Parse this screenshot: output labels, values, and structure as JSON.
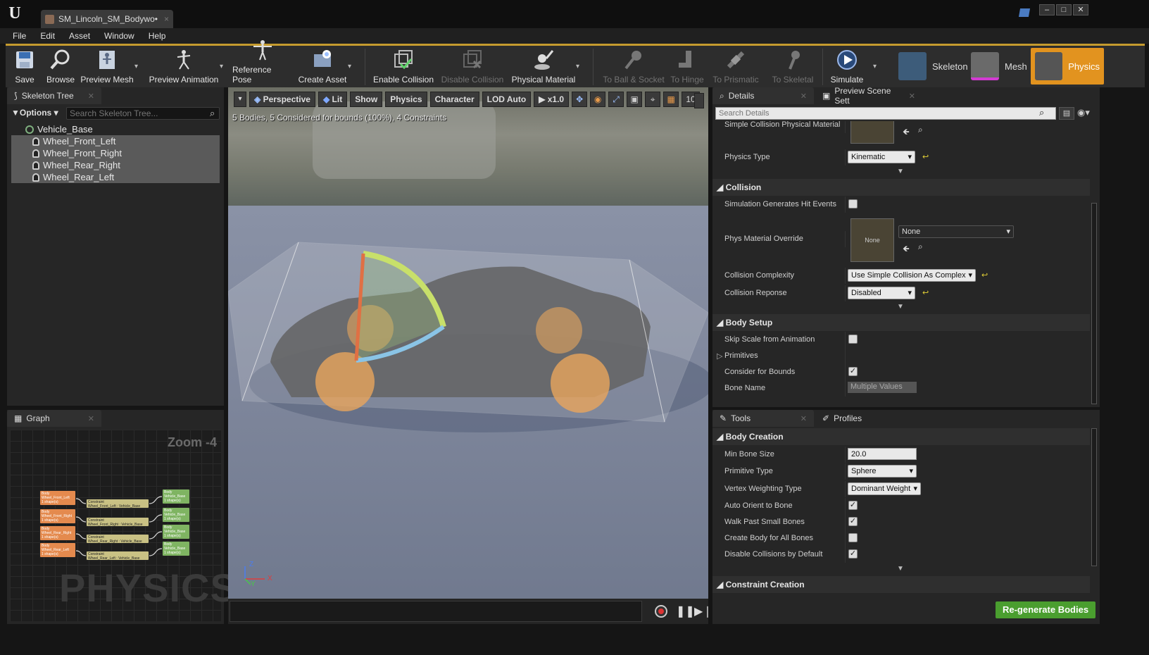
{
  "window": {
    "tab_title": "SM_Lincoln_SM_Bodywo•",
    "tab_close": "×",
    "min": "–",
    "max": "□",
    "close": "✕"
  },
  "menu": [
    "File",
    "Edit",
    "Asset",
    "Window",
    "Help"
  ],
  "toolbar": {
    "save": "Save",
    "browse": "Browse",
    "preview_mesh": "Preview Mesh",
    "preview_animation": "Preview Animation",
    "reference_pose": "Reference Pose",
    "create_asset": "Create Asset",
    "enable_collision": "Enable Collision",
    "disable_collision": "Disable Collision",
    "physical_material": "Physical Material",
    "to_ball_socket": "To Ball & Socket",
    "to_hinge": "To Hinge",
    "to_prismatic": "To Prismatic",
    "to_skeletal": "To Skeletal",
    "simulate": "Simulate",
    "mode_skeleton": "Skeleton",
    "mode_mesh": "Mesh",
    "mode_physics": "Physics"
  },
  "skeleton_tree": {
    "tab": "Skeleton Tree",
    "options": "Options",
    "search_placeholder": "Search Skeleton Tree...",
    "root": "Vehicle_Base",
    "bones": [
      "Wheel_Front_Left",
      "Wheel_Front_Right",
      "Wheel_Rear_Right",
      "Wheel_Rear_Left"
    ]
  },
  "graph": {
    "tab": "Graph",
    "zoom": "Zoom -4",
    "watermark": "PHYSICS",
    "bodies_left": [
      {
        "l1": "Body",
        "l2": "Wheel_Front_Left",
        "l3": "1 shape(s)"
      },
      {
        "l1": "Body",
        "l2": "Wheel_Front_Right",
        "l3": "1 shape(s)"
      },
      {
        "l1": "Body",
        "l2": "Wheel_Rear_Right",
        "l3": "1 shape(s)"
      },
      {
        "l1": "Body",
        "l2": "Wheel_Rear_Left",
        "l3": "1 shape(s)"
      }
    ],
    "constraints": [
      {
        "l1": "Constraint",
        "l2": "Wheel_Front_Left : Vehicle_Base"
      },
      {
        "l1": "Constraint",
        "l2": "Wheel_Front_Right : Vehicle_Base"
      },
      {
        "l1": "Constraint",
        "l2": "Wheel_Rear_Right : Vehicle_Base"
      },
      {
        "l1": "Constraint",
        "l2": "Wheel_Rear_Left : Vehicle_Base"
      }
    ],
    "bodies_right": [
      {
        "l1": "Body",
        "l2": "Vehicle_Base",
        "l3": "1 shape(s)"
      },
      {
        "l1": "Body",
        "l2": "Vehicle_Base",
        "l3": "1 shape(s)"
      },
      {
        "l1": "Body",
        "l2": "Vehicle_Base",
        "l3": "1 shape(s)"
      },
      {
        "l1": "Body",
        "l2": "Vehicle_Base",
        "l3": "1 shape(s)"
      }
    ]
  },
  "viewport": {
    "perspective": "Perspective",
    "lit": "Lit",
    "show": "Show",
    "physics": "Physics",
    "character": "Character",
    "lod": "LOD Auto",
    "speed": "x1.0",
    "grid_value": "10",
    "stats": "5 Bodies, 5 Considered for bounds (100%), 4 Constraints",
    "axis_z": "Z",
    "axis_y": "Y",
    "axis_x": "X"
  },
  "details": {
    "tab": "Details",
    "tab2": "Preview Scene Sett",
    "search_placeholder": "Search Details",
    "simple_collision_label": "Simple Collision Physical Material",
    "none": "None",
    "physics_type_label": "Physics Type",
    "physics_type_value": "Kinematic",
    "collision_cat": "Collision",
    "sim_hit_label": "Simulation Generates Hit Events",
    "phys_override_label": "Phys Material Override",
    "phys_override_value": "None",
    "complexity_label": "Collision Complexity",
    "complexity_value": "Use Simple Collision As Complex",
    "response_label": "Collision Reponse",
    "response_value": "Disabled",
    "body_setup_cat": "Body Setup",
    "skip_scale_label": "Skip Scale from Animation",
    "primitives_label": "Primitives",
    "consider_bounds_label": "Consider for Bounds",
    "bone_name_label": "Bone Name",
    "bone_name_value": "Multiple Values"
  },
  "tools": {
    "tab": "Tools",
    "tab2": "Profiles",
    "body_creation_cat": "Body Creation",
    "min_bone_label": "Min Bone Size",
    "min_bone_value": "20.0",
    "prim_type_label": "Primitive Type",
    "prim_type_value": "Sphere",
    "vertex_label": "Vertex Weighting Type",
    "vertex_value": "Dominant Weight",
    "auto_orient_label": "Auto Orient to Bone",
    "walk_past_label": "Walk Past Small Bones",
    "create_all_label": "Create Body for All Bones",
    "disable_coll_label": "Disable Collisions by Default",
    "constraint_cat": "Constraint Creation",
    "regenerate": "Re-generate Bodies"
  },
  "colors": {
    "accent": "#c59b2e",
    "regenerate": "#4a9e2f",
    "body_node": "#e48a4e",
    "constraint_node": "#c9c184",
    "vehicle_node": "#7fb462"
  }
}
